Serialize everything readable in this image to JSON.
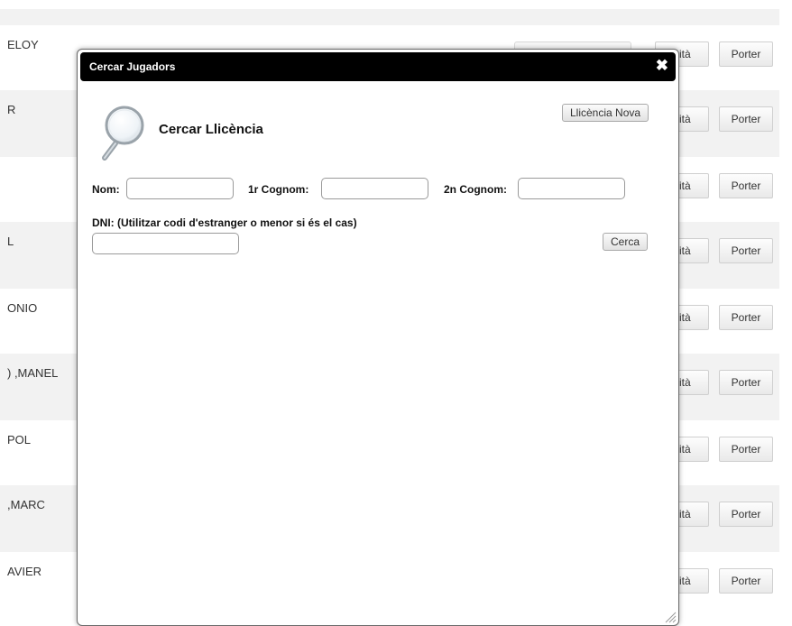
{
  "background": {
    "rows": [
      {
        "name": "ELOY"
      },
      {
        "name": "R"
      },
      {
        "name": ""
      },
      {
        "name": "L"
      },
      {
        "name": "ONIO"
      },
      {
        "name": ") ,MANEL"
      },
      {
        "name": "POL"
      },
      {
        "name": ",MARC"
      },
      {
        "name": "AVIER"
      }
    ],
    "capita_label": "pità",
    "porter_label": "Porter"
  },
  "dialog": {
    "title": "Cercar Jugadors",
    "close_symbol": "✖",
    "heading": "Cercar Llicència",
    "new_license_label": "Llicència Nova",
    "search_label": "Cerca",
    "fields": {
      "nom_label": "Nom:",
      "cognom1_label": "1r Cognom:",
      "cognom2_label": "2n Cognom:",
      "dni_label": "DNI: (Utilitzar codi d'estranger o menor si és el cas)"
    },
    "values": {
      "nom": "",
      "cognom1": "",
      "cognom2": "",
      "dni": ""
    }
  }
}
